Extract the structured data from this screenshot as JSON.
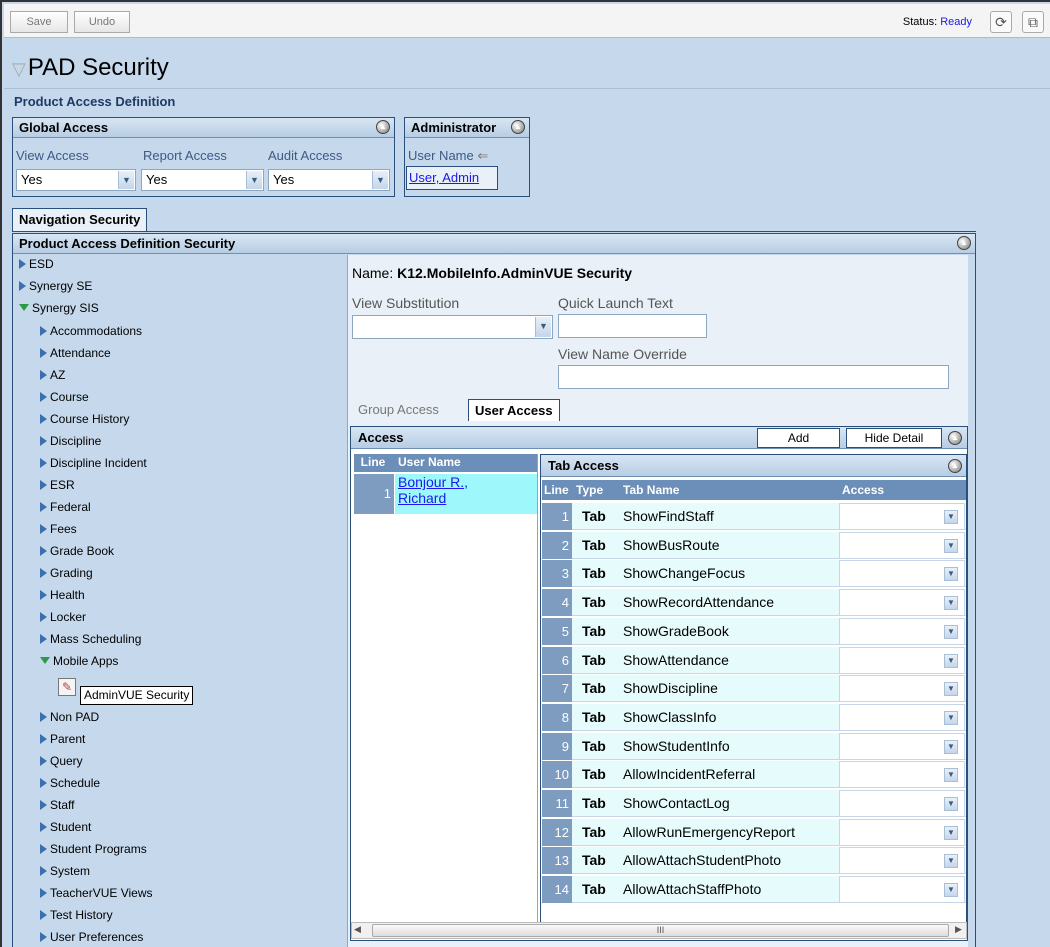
{
  "toolbar": {
    "save_label": "Save",
    "undo_label": "Undo",
    "status_label": "Status:",
    "status_value": "Ready"
  },
  "page": {
    "title": "PAD Security",
    "section_title": "Product Access Definition"
  },
  "global_access": {
    "title": "Global Access",
    "view_label": "View Access",
    "report_label": "Report Access",
    "audit_label": "Audit Access",
    "view_value": "Yes",
    "report_value": "Yes",
    "audit_value": "Yes"
  },
  "administrator": {
    "title": "Administrator",
    "user_name_label": "User Name",
    "user_value": "User, Admin"
  },
  "nav_tab": "Navigation Security",
  "pad_security": {
    "title": "Product Access Definition Security"
  },
  "tree": {
    "top": [
      "ESD",
      "Synergy SE",
      "Synergy SIS"
    ],
    "sis_children": [
      "Accommodations",
      "Attendance",
      "AZ",
      "Course",
      "Course History",
      "Discipline",
      "Discipline Incident",
      "ESR",
      "Federal",
      "Fees",
      "Grade Book",
      "Grading",
      "Health",
      "Locker",
      "Mass Scheduling",
      "Mobile Apps"
    ],
    "mobile_child": "AdminVUE Security",
    "sis_children_after": [
      "Non PAD",
      "Parent",
      "Query",
      "Schedule",
      "Staff",
      "Student",
      "Student Programs",
      "System",
      "TeacherVUE Views",
      "Test History",
      "User Preferences"
    ]
  },
  "detail": {
    "name_label": "Name:",
    "name_value": "K12.MobileInfo.AdminVUE Security",
    "view_sub_label": "View Substitution",
    "quick_launch_label": "Quick Launch Text",
    "view_name_override_label": "View Name Override",
    "tab_group": "Group Access",
    "tab_user": "User Access"
  },
  "access": {
    "title": "Access",
    "add_label": "Add",
    "hide_detail_label": "Hide Detail",
    "col_line": "Line",
    "col_user": "User Name",
    "users": [
      {
        "line": "1",
        "name_line1": "Bonjour R.,",
        "name_line2": "Richard"
      }
    ]
  },
  "tab_access": {
    "title": "Tab Access",
    "col_line": "Line",
    "col_type": "Type",
    "col_name": "Tab Name",
    "col_access": "Access",
    "rows": [
      {
        "line": "1",
        "type": "Tab",
        "name": "ShowFindStaff"
      },
      {
        "line": "2",
        "type": "Tab",
        "name": "ShowBusRoute"
      },
      {
        "line": "3",
        "type": "Tab",
        "name": "ShowChangeFocus"
      },
      {
        "line": "4",
        "type": "Tab",
        "name": "ShowRecordAttendance"
      },
      {
        "line": "5",
        "type": "Tab",
        "name": "ShowGradeBook"
      },
      {
        "line": "6",
        "type": "Tab",
        "name": "ShowAttendance"
      },
      {
        "line": "7",
        "type": "Tab",
        "name": "ShowDiscipline"
      },
      {
        "line": "8",
        "type": "Tab",
        "name": "ShowClassInfo"
      },
      {
        "line": "9",
        "type": "Tab",
        "name": "ShowStudentInfo"
      },
      {
        "line": "10",
        "type": "Tab",
        "name": "AllowIncidentReferral"
      },
      {
        "line": "11",
        "type": "Tab",
        "name": "ShowContactLog"
      },
      {
        "line": "12",
        "type": "Tab",
        "name": "AllowRunEmergencyReport"
      },
      {
        "line": "13",
        "type": "Tab",
        "name": "AllowAttachStudentPhoto"
      },
      {
        "line": "14",
        "type": "Tab",
        "name": "AllowAttachStaffPhoto"
      }
    ]
  },
  "scroll_thumb_glyph": "III",
  "colors": {
    "header_text": "#1f3a63",
    "link": "#1a1aee",
    "line_cell": "#7e9cc0"
  }
}
